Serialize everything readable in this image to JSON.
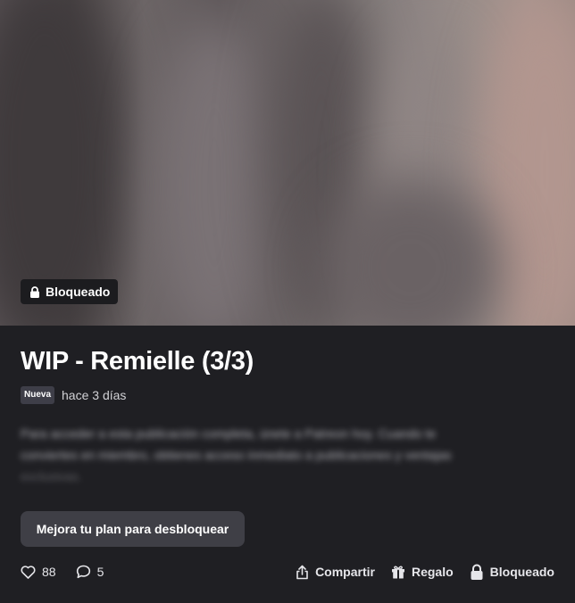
{
  "hero": {
    "locked_label": "Bloqueado"
  },
  "post": {
    "title": "WIP - Remielle (3/3)",
    "badge_new": "Nueva",
    "timestamp": "hace 3 días",
    "blurred_lines": [
      "Para acceder a esta publicación completa, únete a Patreon hoy. Cuando te",
      "conviertes en miembro, obtienes acceso inmediato a publicaciones y ventajas",
      "exclusivas."
    ]
  },
  "upgrade_button": {
    "label": "Mejora tu plan para desbloquear"
  },
  "actions": {
    "likes_count": "88",
    "comments_count": "5",
    "share_label": "Compartir",
    "gift_label": "Regalo",
    "locked_label": "Bloqueado"
  },
  "icons": {
    "lock": "lock-icon",
    "heart": "heart-icon",
    "comment": "comment-icon",
    "share": "share-icon",
    "gift": "gift-icon"
  }
}
